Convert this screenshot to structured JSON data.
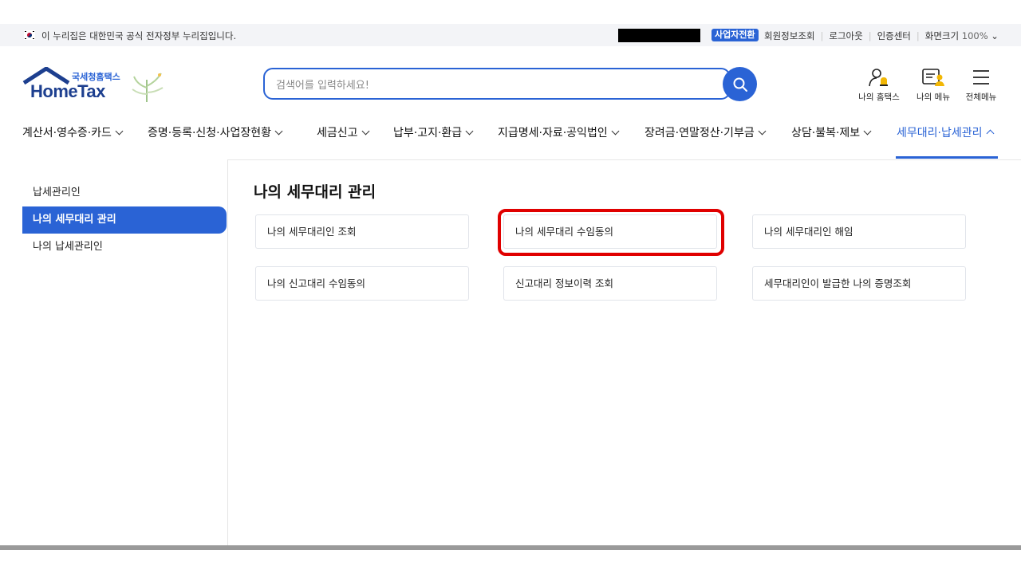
{
  "topbar": {
    "gov_notice": "이 누리집은 대한민국 공식 전자정부 누리집입니다.",
    "business_switch": "사업자전환",
    "links": [
      "회원정보조회",
      "로그아웃",
      "인증센터"
    ],
    "zoom_label": "화면크기",
    "zoom_value": "100%"
  },
  "logo": {
    "korean": "국세청홈택스",
    "english": "HomeTax"
  },
  "search": {
    "placeholder": "검색어를 입력하세요!"
  },
  "header_icons": {
    "my_hometax": "나의 홈택스",
    "my_menu": "나의 메뉴",
    "all_menu": "전체메뉴"
  },
  "gnb": {
    "items": [
      "계산서·영수증·카드",
      "증명·등록·신청·사업장현황",
      "세금신고",
      "납부·고지·환급",
      "지급명세·자료·공익법인",
      "장려금·연말정산·기부금",
      "상담·불복·제보",
      "세무대리·납세관리"
    ]
  },
  "sidebar": {
    "items": [
      "납세관리인",
      "나의 세무대리 관리",
      "나의 납세관리인"
    ]
  },
  "main": {
    "title": "나의 세무대리 관리",
    "cards": [
      "나의 세무대리인 조회",
      "나의 세무대리 수임동의",
      "나의 세무대리인 해임",
      "나의 신고대리 수임동의",
      "신고대리 정보이력 조회",
      "세무대리인이 발급한 나의 증명조회"
    ]
  },
  "colors": {
    "accent": "#2a63d5",
    "highlight": "#e00000"
  }
}
